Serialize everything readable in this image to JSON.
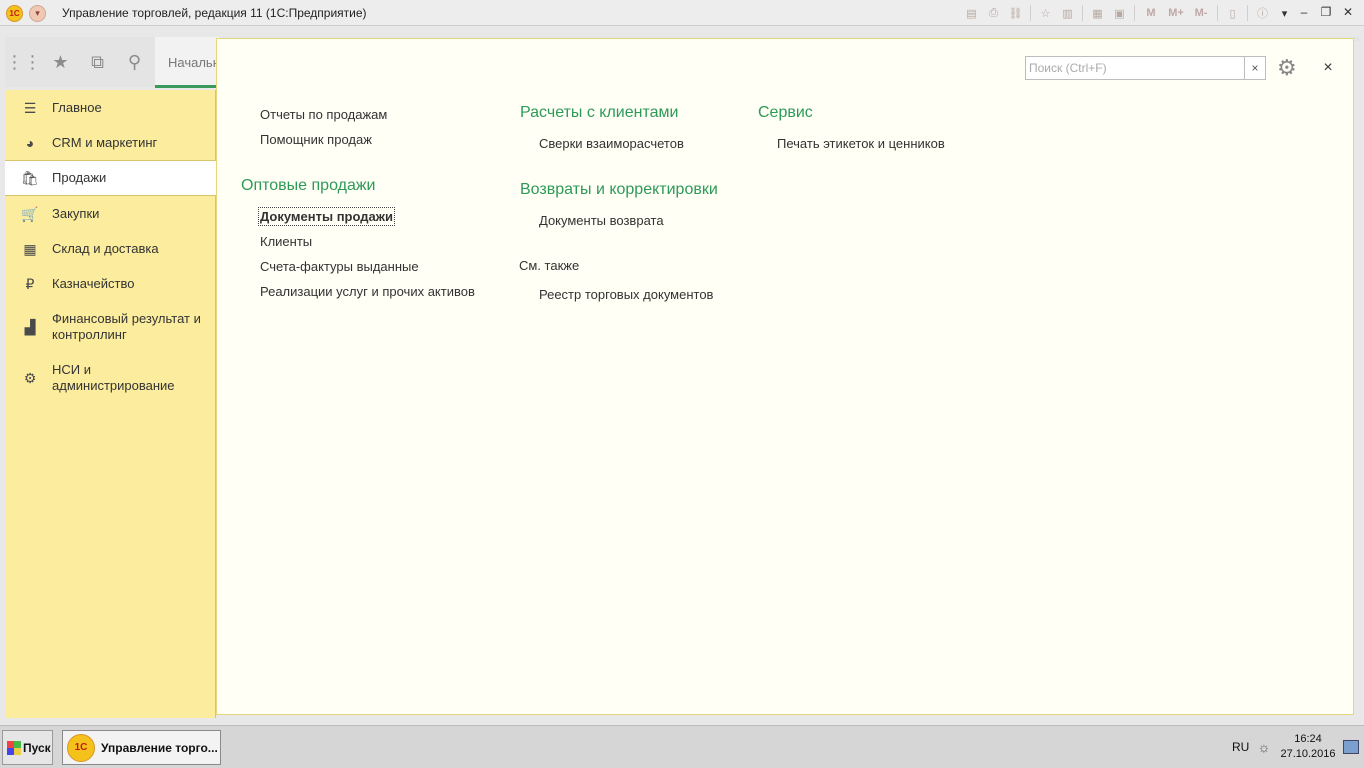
{
  "window": {
    "title": "Управление торговлей, редакция 11  (1С:Предприятие)",
    "logo_text": "1С",
    "toolbar_m": "M",
    "toolbar_m_plus": "M+",
    "toolbar_m_minus": "M-"
  },
  "tabs": {
    "home_label": "Начальная страница"
  },
  "sidebar": {
    "items": [
      {
        "label": "Главное",
        "icon": "menu-lines-icon"
      },
      {
        "label": "CRM и маркетинг",
        "icon": "pie-chart-icon"
      },
      {
        "label": "Продажи",
        "icon": "shopping-bag-icon"
      },
      {
        "label": "Закупки",
        "icon": "cart-icon"
      },
      {
        "label": "Склад и доставка",
        "icon": "warehouse-grid-icon"
      },
      {
        "label": "Казначейство",
        "icon": "ruble-coin-icon"
      },
      {
        "label": "Финансовый результат и контроллинг",
        "icon": "bar-chart-icon"
      },
      {
        "label": "НСИ и администрирование",
        "icon": "gear-icon"
      }
    ],
    "active_index": 2
  },
  "search": {
    "placeholder": "Поиск (Ctrl+F)",
    "clear": "×"
  },
  "close_label": "×",
  "content": {
    "col1_top_links": [
      "Отчеты по продажам",
      "Помощник продаж"
    ],
    "wholesale_title": "Оптовые продажи",
    "wholesale_links": [
      "Документы продажи",
      "Клиенты",
      "Счета-фактуры выданные",
      "Реализации услуг и прочих активов"
    ],
    "settlements_title": "Расчеты с клиентами",
    "settlements_links": [
      "Сверки взаиморасчетов"
    ],
    "returns_title": "Возвраты и корректировки",
    "returns_links": [
      "Документы возврата"
    ],
    "see_also_title": "См. также",
    "see_also_links": [
      "Реестр торговых документов"
    ],
    "service_title": "Сервис",
    "service_links": [
      "Печать этикеток и ценников"
    ]
  },
  "taskbar": {
    "start_label": "Пуск",
    "task_label": "Управление торго...",
    "language": "RU",
    "time": "16:24",
    "date": "27.10.2016"
  },
  "colors": {
    "sidebar_bg": "#fbec9e",
    "group_title": "#2e9a58",
    "panel_bg": "#fffff6"
  }
}
